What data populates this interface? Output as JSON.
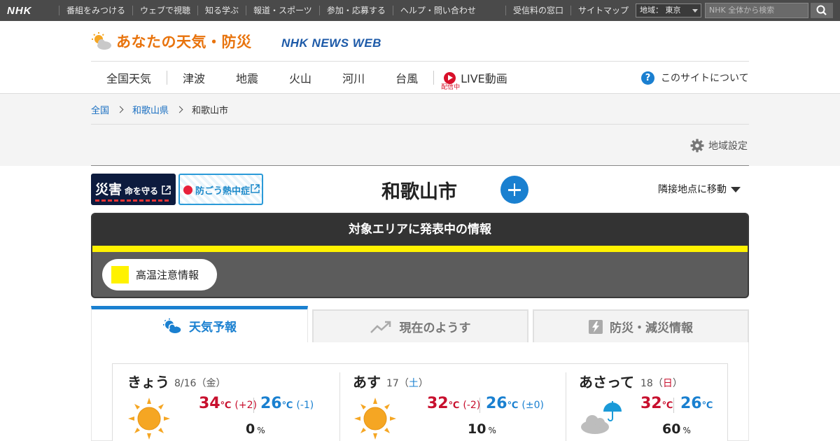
{
  "global_bar": {
    "logo": "NHK",
    "nav": [
      "番組をみつける",
      "ウェブで視聴",
      "知る学ぶ",
      "報道・スポーツ",
      "参加・応募する",
      "ヘルプ・問い合わせ"
    ],
    "nav_right": [
      "受信料の窓口",
      "サイトマップ"
    ],
    "region_label": "地域： 東京",
    "search_placeholder": "NHK 全体から検索"
  },
  "header": {
    "brand_title": "あなたの天気・防災",
    "news_web": "NHK NEWS WEB",
    "menu": [
      "全国天気",
      "津波",
      "地震",
      "火山",
      "河川",
      "台風"
    ],
    "live_label": "LIVE動画",
    "live_badge": "配信中",
    "about_label": "このサイトについて"
  },
  "breadcrumb": [
    "全国",
    "和歌山県",
    "和歌山市"
  ],
  "region_setting": "地域設定",
  "banners": {
    "disaster_big": "災害",
    "disaster_small": "命を守る",
    "heat": "防ごう熱中症"
  },
  "city_name": "和歌山市",
  "nearby_label": "隣接地点に移動",
  "alert": {
    "title": "対象エリアに発表中の情報",
    "items": [
      {
        "label": "高温注意情報",
        "color": "#fff200"
      }
    ]
  },
  "tabs": [
    "天気予報",
    "現在のようす",
    "防災・減災情報"
  ],
  "forecast": [
    {
      "day": "きょう",
      "date": "8/16",
      "weekday": "金",
      "weekday_color": "#555555",
      "hi": "34",
      "hi_diff": "(+2)",
      "lo": "26",
      "lo_diff": "(-1)",
      "pop": "0",
      "icon": "sun-icon"
    },
    {
      "day": "あす",
      "date": "17",
      "weekday": "土",
      "weekday_color": "#1a80d0",
      "hi": "32",
      "hi_diff": "(-2)",
      "lo": "26",
      "lo_diff": "(±0)",
      "pop": "10",
      "icon": "sun-icon"
    },
    {
      "day": "あさって",
      "date": "18",
      "weekday": "日",
      "weekday_color": "#c8102e",
      "hi": "32",
      "hi_diff": "",
      "lo": "26",
      "lo_diff": "",
      "pop": "60",
      "icon": "cloud-umbrella-icon"
    }
  ],
  "units": {
    "temp": "℃",
    "pop": "%"
  }
}
